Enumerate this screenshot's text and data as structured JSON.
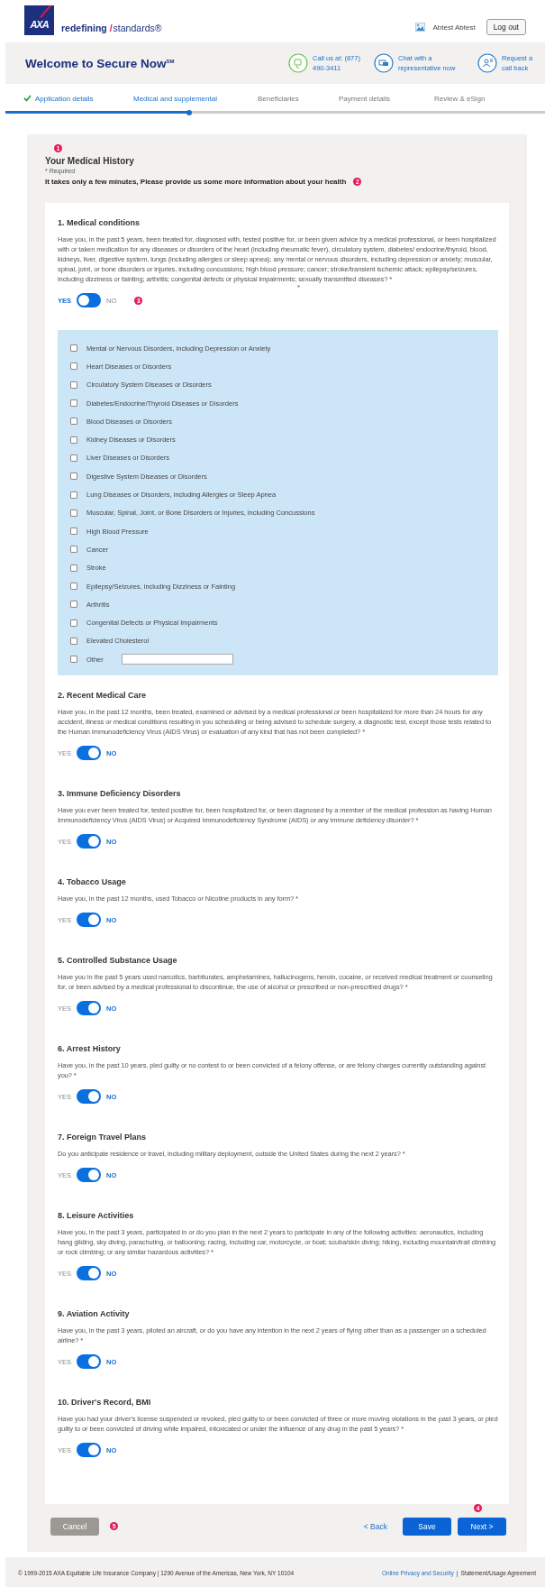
{
  "header": {
    "logo": {
      "text": "AXA"
    },
    "tagline": {
      "strong": "redefining",
      "slash": "/",
      "rest": "standards®"
    },
    "user": {
      "name": "Abtest Abtest"
    },
    "logout_button": "Log out"
  },
  "banner": {
    "title": "Welcome to Secure Now$^{SM}$",
    "contacts": [
      {
        "kind": "phone",
        "text": "Call us at: (877) 490-3411"
      },
      {
        "kind": "chat",
        "text": "Chat with a representative now"
      },
      {
        "kind": "callback",
        "text": "Request a call back"
      }
    ]
  },
  "steps": [
    {
      "label": "Application details",
      "completed": true,
      "active": true
    },
    {
      "label": "Medical and supplemental",
      "completed": false,
      "active": true
    },
    {
      "label": "Beneficiaries",
      "completed": false,
      "active": false
    },
    {
      "label": "Payment details",
      "completed": false,
      "active": false
    },
    {
      "label": "Review & eSign",
      "completed": false,
      "active": false
    }
  ],
  "progress": {
    "level": 0.34
  },
  "section": {
    "marker": "1",
    "title": "Your Medical History",
    "required_note": "* Required",
    "intro": "It takes only a few minutes, Please provide us some more information about your health",
    "intro_marker": "2"
  },
  "questions": [
    {
      "title": "1. Medical conditions",
      "text": "Have you, in the past 5 years, been treated for, diagnosed with, tested positive for, or been given advice by a medical professional, or been hospitalized with or taken medication for any diseases or disorders of the heart (including rheumatic fever), circulatory system, diabetes/ endocrine/thyroid, blood, kidneys, liver, digestive system, lungs (including allergies or sleep apnea); any mental or nervous disorders, including depression or anxiety; muscular, spinal, joint, or bone disorders or injuries, including concussions; high blood pressure; cancer; stroke/transient ischemic attack; epilepsy/seizures, including dizziness or fainting; arthritis; congenital defects or physical impairments; sexually transmitted diseases? *",
      "stray": "*",
      "marker": "3",
      "options": [
        {
          "label": "YES",
          "selected": true
        },
        {
          "label": "NO",
          "selected": false
        }
      ],
      "conditions": [
        {
          "kind": "checkbox",
          "label": "Mental or Nervous Disorders, including Depression or Anxiety",
          "checked": false
        },
        {
          "kind": "checkbox",
          "label": "Heart Diseases or Disorders",
          "checked": false
        },
        {
          "kind": "checkbox",
          "label": "Circulatory System Diseases or Disorders",
          "checked": false
        },
        {
          "kind": "checkbox",
          "label": "Diabetes/Endocrine/Thyroid Diseases or Disorders",
          "checked": false
        },
        {
          "kind": "checkbox",
          "label": "Blood Diseases or Disorders",
          "checked": false
        },
        {
          "kind": "checkbox",
          "label": "Kidney Diseases or Disorders",
          "checked": false
        },
        {
          "kind": "checkbox",
          "label": "Liver Diseases or Disorders",
          "checked": false
        },
        {
          "kind": "checkbox",
          "label": "Digestive System Diseases or Disorders",
          "checked": false
        },
        {
          "kind": "checkbox",
          "label": "Lung Diseases or Disorders, including Allergies or Sleep Apnea",
          "checked": false
        },
        {
          "kind": "checkbox",
          "label": "Muscular, Spinal, Joint, or Bone Disorders or Injuries, including Concussions",
          "checked": false
        },
        {
          "kind": "checkbox",
          "label": "High Blood Pressure",
          "checked": false
        },
        {
          "kind": "checkbox",
          "label": "Cancer",
          "checked": false
        },
        {
          "kind": "checkbox",
          "label": "Stroke",
          "checked": false
        },
        {
          "kind": "checkbox",
          "label": "Epilepsy/Seizures, including Dizziness or Fainting",
          "checked": false
        },
        {
          "kind": "checkbox",
          "label": "Arthritis",
          "checked": false
        },
        {
          "kind": "checkbox",
          "label": "Congenital Defects or Physical Impairments",
          "checked": false
        },
        {
          "kind": "checkbox",
          "label": "Elevated Cholesterol",
          "checked": false
        },
        {
          "kind": "other",
          "label": "Other",
          "checked": false
        }
      ]
    },
    {
      "title": "2. Recent Medical Care",
      "text": "Have you, in the past 12 months, been treated, examined or advised by a medical professional or been hospitalized for more than 24 hours for any accident, illness or medical conditions resulting in you scheduling or being advised to schedule surgery, a diagnostic test, except those tests related to the Human Immunodeficiency Virus (AIDS Virus) or evaluation of any kind that has not been completed? *",
      "options": [
        {
          "label": "YES",
          "selected": false
        },
        {
          "label": "NO",
          "selected": true
        }
      ]
    },
    {
      "title": "3. Immune Deficiency Disorders",
      "text": "Have you ever been treated for, tested positive for, been hospitalized for, or been diagnosed by a member of the medical profession as having Human Immunodeficiency Virus (AIDS Virus) or Acquired Immunodeficiency Syndrome (AIDS) or any immune deficiency disorder? *",
      "options": [
        {
          "label": "YES",
          "selected": false
        },
        {
          "label": "NO",
          "selected": true
        }
      ]
    },
    {
      "title": "4. Tobacco Usage",
      "text": "Have you, in the past 12 months, used Tobacco or Nicotine products in any form? *",
      "options": [
        {
          "label": "YES",
          "selected": false
        },
        {
          "label": "NO",
          "selected": true
        }
      ]
    },
    {
      "title": "5. Controlled Substance Usage",
      "text": "Have you in the past 5 years used narcotics, barbiturates, amphetamines, hallucinogens, heroin, cocaine, or received medical treatment or counseling for, or been advised by a medical professional to discontinue, the use of alcohol or prescribed or non-prescribed drugs? *",
      "options": [
        {
          "label": "YES",
          "selected": false
        },
        {
          "label": "NO",
          "selected": true
        }
      ]
    },
    {
      "title": "6. Arrest History",
      "text": "Have you, in the past 10 years, pled guilty or no contest to or been convicted of a felony offense, or are felony charges currently outstanding against you? *",
      "options": [
        {
          "label": "YES",
          "selected": false
        },
        {
          "label": "NO",
          "selected": true
        }
      ]
    },
    {
      "title": "7. Foreign Travel Plans",
      "text": "Do you anticipate residence or travel, including military deployment, outside the United States during the next 2 years? *",
      "options": [
        {
          "label": "YES",
          "selected": false
        },
        {
          "label": "NO",
          "selected": true
        }
      ]
    },
    {
      "title": "8. Leisure Activities",
      "text": "Have you, in the past 3 years, participated in or do you plan in the next 2 years to participate in any of the following activities: aeronautics, including hang gliding, sky diving, parachuting, or ballooning; racing, including car, motorcycle, or boat; scuba/skin diving; hiking, including mountain/trail climbing or rock climbing; or any similar hazardous activities? *",
      "options": [
        {
          "label": "YES",
          "selected": false
        },
        {
          "label": "NO",
          "selected": true
        }
      ]
    },
    {
      "title": "9. Aviation Activity",
      "text": "Have you, in the past 3 years, piloted an aircraft, or do you have any intention in the next 2 years of flying other than as a passenger on a scheduled airline? *",
      "options": [
        {
          "label": "YES",
          "selected": false
        },
        {
          "label": "NO",
          "selected": true
        }
      ]
    },
    {
      "title": "10. Driver's Record, BMI",
      "text": "Have you had your driver's license suspended or revoked, pled guilty to or been convicted of three or more moving violations in the past 3 years, or pled guilty to or been convicted of driving while impaired, intoxicated or under the influence of any drug in the past 5 years? *",
      "options": [
        {
          "label": "YES",
          "selected": false
        },
        {
          "label": "NO",
          "selected": true
        }
      ]
    }
  ],
  "actions": {
    "cancel": "Cancel",
    "cancel_marker": "5",
    "back": "< Back",
    "save": "Save",
    "next": "Next >",
    "next_marker": "4"
  },
  "footer": {
    "copyright": "© 1999-2015 AXA Equitable Life Insurance Company | 1290 Avenue of the Americas, New York, NY 10104",
    "links": [
      {
        "kind": "link",
        "text": "Online Privacy and Security"
      },
      {
        "kind": "plain",
        "text": "|"
      },
      {
        "kind": "plain",
        "text": "Statement/Usage Agreement"
      }
    ]
  }
}
